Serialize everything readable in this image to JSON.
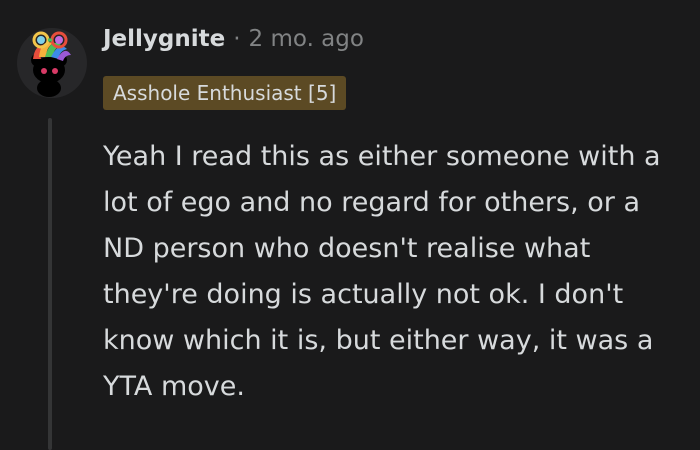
{
  "comment": {
    "author": "Jellygnite",
    "separator": "·",
    "timestamp": "2 mo. ago",
    "flair": "Asshole Enthusiast [5]",
    "body": "Yeah I read this as either someone with a lot of ego and no regard for others, or a ND person who doesn't realise what they're doing is actually not ok. I don't know which it is, but either way, it was a YTA move."
  },
  "colors": {
    "background": "#1a1a1b",
    "text": "#d7dadc",
    "muted": "#818384",
    "flair_bg": "#5c4a24",
    "thread_line": "#343536"
  },
  "icons": {
    "avatar": "snoo-avatar-icon"
  }
}
